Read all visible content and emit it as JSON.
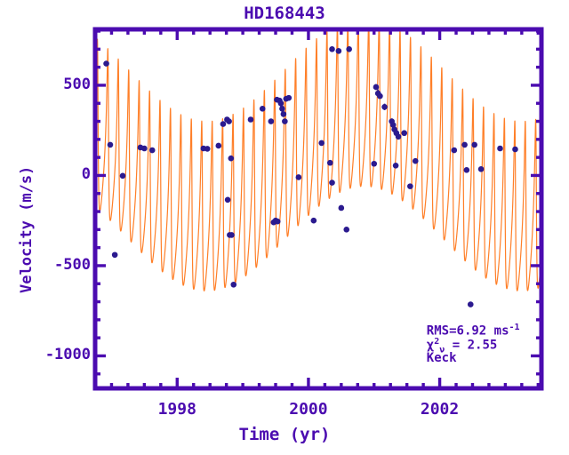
{
  "chart_data": {
    "type": "line",
    "title": "HD168443",
    "xlabel": "Time  (yr)",
    "ylabel": "Velocity (m/s)",
    "xlim": [
      1996.75,
      2003.55
    ],
    "ylim": [
      -1180,
      810
    ],
    "xticks": [
      1998,
      2000,
      2002
    ],
    "xtick_labels": [
      "1998",
      "2000",
      "2002"
    ],
    "yticks": [
      500,
      0,
      -500,
      -1000
    ],
    "ytick_labels": [
      "500",
      "0",
      "-500",
      "-1000"
    ],
    "x_minor_tick_step": 0.25,
    "y_minor_tick_step": 100,
    "grid": false,
    "legend": "none",
    "line_color": "#ff7f28",
    "marker_color": "#2b1a8f",
    "axis_color": "#4b0bb0",
    "model": {
      "description": "two-planet Keplerian radial velocity model: rapid inner-planet oscillation modulated by a long-period outer-planet envelope",
      "inner_period_yr": 0.159,
      "inner_amplitude": 470,
      "outer_period_yr": 4.8,
      "outer_amplitude": 290,
      "outer_offset": -35,
      "outer_phase_peak_yr": 2000.85,
      "inner_phase_ref_yr": 1996.95,
      "inner_eccentricity": 0.53
    },
    "series": [
      {
        "name": "Keplerian model",
        "type": "line",
        "color": "#ff7f28"
      },
      {
        "name": "Keck radial velocities",
        "type": "scatter",
        "color": "#2b1a8f",
        "points": [
          {
            "x": 1996.92,
            "y": 620,
            "err": 12
          },
          {
            "x": 1996.98,
            "y": 170,
            "err": 12
          },
          {
            "x": 1997.05,
            "y": -440,
            "err": 12
          },
          {
            "x": 1997.17,
            "y": -2,
            "err": 14
          },
          {
            "x": 1997.44,
            "y": 155,
            "err": 12
          },
          {
            "x": 1997.5,
            "y": 150,
            "err": 12
          },
          {
            "x": 1997.62,
            "y": 140,
            "err": 12
          },
          {
            "x": 1998.4,
            "y": 150,
            "err": 12
          },
          {
            "x": 1998.46,
            "y": 148,
            "err": 12
          },
          {
            "x": 1998.63,
            "y": 165,
            "err": 14
          },
          {
            "x": 1998.7,
            "y": 285,
            "err": 12
          },
          {
            "x": 1998.76,
            "y": 310,
            "err": 12
          },
          {
            "x": 1998.79,
            "y": 300,
            "err": 12
          },
          {
            "x": 1998.82,
            "y": 95,
            "err": 12
          },
          {
            "x": 1998.77,
            "y": -135,
            "err": 14
          },
          {
            "x": 1998.8,
            "y": -330,
            "err": 12
          },
          {
            "x": 1998.83,
            "y": -330,
            "err": 12
          },
          {
            "x": 1998.86,
            "y": -605,
            "err": 12
          },
          {
            "x": 1999.12,
            "y": 310,
            "err": 12
          },
          {
            "x": 1999.3,
            "y": 370,
            "err": 12
          },
          {
            "x": 1999.43,
            "y": 300,
            "err": 12
          },
          {
            "x": 1999.52,
            "y": 420,
            "err": 12
          },
          {
            "x": 1999.56,
            "y": 415,
            "err": 12
          },
          {
            "x": 1999.58,
            "y": 400,
            "err": 20
          },
          {
            "x": 1999.6,
            "y": 370,
            "err": 24
          },
          {
            "x": 1999.62,
            "y": 340,
            "err": 14
          },
          {
            "x": 1999.64,
            "y": 300,
            "err": 12
          },
          {
            "x": 1999.66,
            "y": 425,
            "err": 12
          },
          {
            "x": 1999.7,
            "y": 430,
            "err": 12
          },
          {
            "x": 1999.47,
            "y": -260,
            "err": 14
          },
          {
            "x": 1999.5,
            "y": -250,
            "err": 12
          },
          {
            "x": 1999.53,
            "y": -255,
            "err": 12
          },
          {
            "x": 1999.85,
            "y": -10,
            "err": 12
          },
          {
            "x": 2000.08,
            "y": -250,
            "err": 12
          },
          {
            "x": 2000.2,
            "y": 180,
            "err": 12
          },
          {
            "x": 2000.36,
            "y": 700,
            "err": 12
          },
          {
            "x": 2000.46,
            "y": 690,
            "err": 12
          },
          {
            "x": 2000.62,
            "y": 700,
            "err": 12
          },
          {
            "x": 2000.33,
            "y": 70,
            "err": 12
          },
          {
            "x": 2000.36,
            "y": -40,
            "err": 14
          },
          {
            "x": 2000.5,
            "y": -180,
            "err": 12
          },
          {
            "x": 2000.58,
            "y": -300,
            "err": 12
          },
          {
            "x": 2001.03,
            "y": 490,
            "err": 16
          },
          {
            "x": 2001.06,
            "y": 455,
            "err": 22
          },
          {
            "x": 2001.09,
            "y": 440,
            "err": 14
          },
          {
            "x": 2001.16,
            "y": 380,
            "err": 18
          },
          {
            "x": 2001.27,
            "y": 300,
            "err": 16
          },
          {
            "x": 2001.29,
            "y": 280,
            "err": 22
          },
          {
            "x": 2001.31,
            "y": 255,
            "err": 12
          },
          {
            "x": 2001.34,
            "y": 235,
            "err": 12
          },
          {
            "x": 2001.37,
            "y": 215,
            "err": 14
          },
          {
            "x": 2001.0,
            "y": 65,
            "err": 12
          },
          {
            "x": 2001.33,
            "y": 55,
            "err": 12
          },
          {
            "x": 2001.46,
            "y": 235,
            "err": 12
          },
          {
            "x": 2001.55,
            "y": -60,
            "err": 12
          },
          {
            "x": 2001.63,
            "y": 80,
            "err": 12
          },
          {
            "x": 2002.22,
            "y": 140,
            "err": 12
          },
          {
            "x": 2002.38,
            "y": 170,
            "err": 12
          },
          {
            "x": 2002.53,
            "y": 170,
            "err": 12
          },
          {
            "x": 2002.41,
            "y": 30,
            "err": 12
          },
          {
            "x": 2002.63,
            "y": 35,
            "err": 12
          },
          {
            "x": 2002.92,
            "y": 150,
            "err": 12
          },
          {
            "x": 2003.15,
            "y": 145,
            "err": 12
          },
          {
            "x": 2002.47,
            "y": -715,
            "err": 12
          }
        ]
      }
    ],
    "annotations": [
      {
        "name": "rms",
        "text": "RMS=6.92 ms",
        "sup": "-1",
        "x": 2001.8,
        "y": -860
      },
      {
        "name": "chi-squared",
        "text_prefix": "χ",
        "sup": "2",
        "sub": "ν",
        "text": " = 2.55",
        "x": 2001.8,
        "y": -940
      },
      {
        "name": "dataset",
        "text": "Keck",
        "x": 2001.8,
        "y": -1015
      }
    ]
  },
  "labels": {
    "title": "HD168443",
    "xtitle": "Time  (yr)",
    "ytitle": "Velocity (m/s)"
  }
}
